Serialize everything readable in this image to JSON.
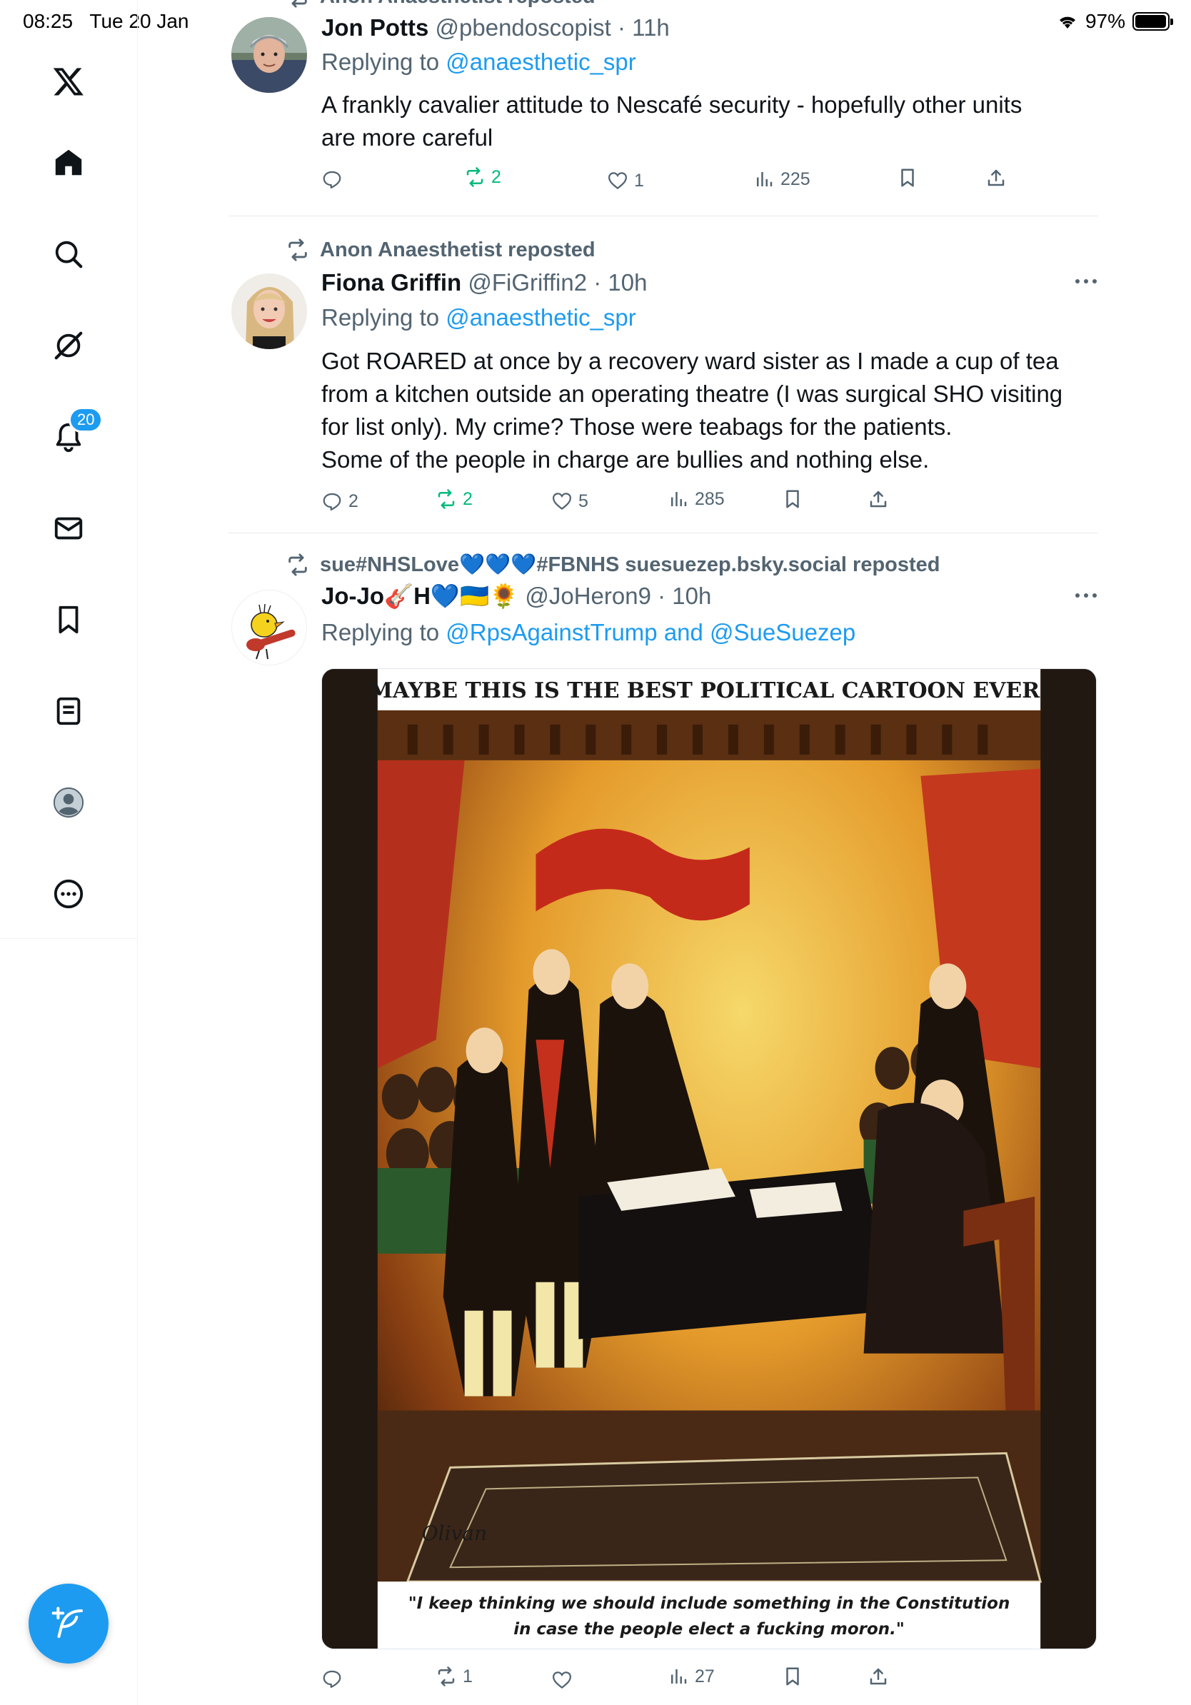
{
  "status_bar": {
    "time": "08:25",
    "date": "Tue 20 Jan",
    "battery": "97%"
  },
  "sidebar": {
    "notifications_badge": "20"
  },
  "posts": [
    {
      "repost_label": "Anon Anaesthetist reposted",
      "name": "Jon Potts",
      "handle_time": "@pbendoscopist · 11h",
      "replying_prefix": "Replying to",
      "replying_to": "@anaesthetic_spr",
      "text_lines": [
        "A frankly cavalier attitude to Nescafé security - hopefully other units",
        "are more careful"
      ],
      "stats": {
        "replies": "",
        "reposts": "2",
        "likes": "1",
        "views": "225"
      }
    },
    {
      "repost_label": "Anon Anaesthetist reposted",
      "name": "Fiona Griffin",
      "handle_time": "@FiGriffin2 · 10h",
      "replying_prefix": "Replying to",
      "replying_to": "@anaesthetic_spr",
      "text_lines": [
        "Got ROARED at once by a recovery ward sister as I made a cup of tea",
        "from a kitchen outside an operating theatre (I was surgical SHO visiting",
        "for list only). My crime? Those were teabags for the patients.",
        "Some of the people in charge are bullies and nothing else."
      ],
      "stats": {
        "replies": "2",
        "reposts": "2",
        "likes": "5",
        "views": "285"
      }
    },
    {
      "repost_label": "sue#NHSLove💙💙💙#FBNHS suesuezep.bsky.social reposted",
      "name": "Jo-Jo🎸H💙🇺🇦🌻",
      "handle_time": "@JoHeron9 · 10h",
      "replying_prefix": "Replying to",
      "replying_to": "@RpsAgainstTrump and @SueSuezep",
      "media": {
        "headline": "MAYBE THIS IS THE BEST POLITICAL CARTOON EVER!",
        "caption_line1": "\"I keep thinking we should include something in the Constitution",
        "caption_line2": "in case the people elect a fucking moron.\"",
        "signature": "Olivan"
      },
      "stats": {
        "replies": "",
        "reposts": "1",
        "likes": "",
        "views": "27"
      }
    }
  ],
  "colors": {
    "accent": "#1d9bf0",
    "muted": "#536471",
    "repost_green": "#00ba7c"
  }
}
